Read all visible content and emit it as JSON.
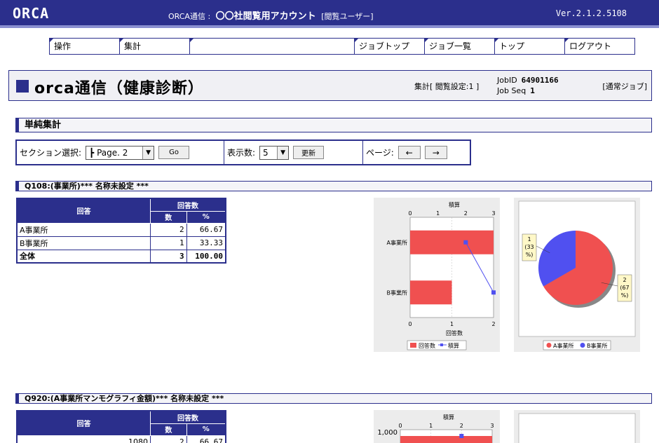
{
  "header": {
    "logo": "ORCA",
    "service_label": "ORCA通信 :",
    "account_name": "〇〇社閲覧用アカウント",
    "user_role": "[閲覧ユーザー]",
    "version": "Ver.2.1.2.5108"
  },
  "menu": {
    "items": [
      {
        "label": "操作"
      },
      {
        "label": "集計"
      },
      {
        "label": ""
      },
      {
        "label": "ジョブトップ"
      },
      {
        "label": "ジョブ一覧"
      },
      {
        "label": "トップ"
      },
      {
        "label": "ログアウト"
      }
    ]
  },
  "title": {
    "text": "orca通信（健康診断）",
    "aggregation": "集計[ 閲覧設定:1 ]",
    "job_id_label": "JobID",
    "job_id": "64901166",
    "job_seq_label": "Job Seq",
    "job_seq": "1",
    "job_type": "[通常ジョブ]"
  },
  "section": {
    "title": "単純集計"
  },
  "controls": {
    "section_label": "セクション選択:",
    "section_value": "┣ Page. 2",
    "go_label": "Go",
    "count_label": "表示数:",
    "count_value": "5",
    "update_label": "更新",
    "page_label": "ページ:",
    "prev_label": "←",
    "next_label": "→"
  },
  "q1": {
    "title": "Q108:(事業所)*** 名称未設定 ***",
    "table": {
      "header_answer": "回答",
      "header_count_group": "回答数",
      "header_count": "数",
      "header_pct": "%",
      "rows": [
        {
          "label": "A事業所",
          "count": "2",
          "pct": "66.67"
        },
        {
          "label": "B事業所",
          "count": "1",
          "pct": "33.33"
        }
      ],
      "total": {
        "label": "全体",
        "count": "3",
        "pct": "100.00"
      }
    }
  },
  "q2": {
    "title": "Q920:(A事業所マンモグラフィ金額)*** 名称未設定 ***",
    "table": {
      "header_answer": "回答",
      "header_count_group": "回答数",
      "header_count": "数",
      "header_pct": "%",
      "rows": [
        {
          "label": "1080",
          "count": "2",
          "pct": "66.67"
        }
      ]
    }
  },
  "colors": {
    "navy": "#2b2f8c",
    "bar_red": "#f05050",
    "line_blue": "#5050f0"
  },
  "chart_data": [
    {
      "type": "bar",
      "orientation": "horizontal",
      "categories": [
        "A事業所",
        "B事業所"
      ],
      "series": [
        {
          "name": "回答数",
          "values": [
            2,
            1
          ]
        },
        {
          "name": "積算",
          "values": [
            2,
            3
          ]
        }
      ],
      "xlabel": "回答数",
      "top_axis_label": "積算",
      "xlim": [
        0,
        2
      ],
      "top_xlim": [
        0,
        3
      ],
      "x_ticks": [
        "0",
        "1",
        "2"
      ],
      "top_ticks": [
        "0",
        "1",
        "2",
        "3"
      ],
      "legend_placement": "bottom",
      "grid": true
    },
    {
      "type": "pie",
      "labels": [
        "A事業所",
        "B事業所"
      ],
      "values": [
        2,
        1
      ],
      "slice_labels": [
        [
          "2",
          "(67",
          "%)"
        ],
        [
          "1",
          "(33",
          "%)"
        ]
      ],
      "legend_placement": "bottom"
    },
    {
      "type": "bar",
      "orientation": "horizontal",
      "categories": [
        "1,000"
      ],
      "series": [
        {
          "name": "回答数",
          "values": [
            2
          ]
        },
        {
          "name": "積算",
          "values": [
            2
          ]
        }
      ],
      "top_axis_label": "積算",
      "top_xlim": [
        0,
        3
      ],
      "top_ticks": [
        "0",
        "1",
        "2",
        "3"
      ],
      "grid": true
    }
  ]
}
